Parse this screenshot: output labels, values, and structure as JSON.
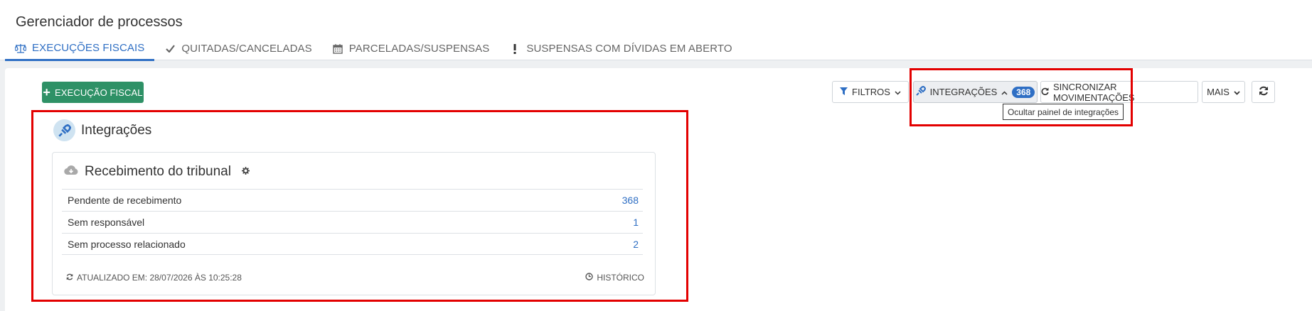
{
  "header": {
    "title": "Gerenciador de processos",
    "tabs": [
      {
        "label": "EXECUÇÕES FISCAIS",
        "icon": "scale-icon",
        "active": true
      },
      {
        "label": "QUITADAS/CANCELADAS",
        "icon": "check-icon",
        "active": false
      },
      {
        "label": "PARCELADAS/SUSPENSAS",
        "icon": "calendar-icon",
        "active": false
      },
      {
        "label": "SUSPENSAS COM DÍVIDAS EM ABERTO",
        "icon": "exclamation-icon",
        "active": false
      }
    ]
  },
  "actions": {
    "new_label": "EXECUÇÃO FISCAL",
    "filters_label": "FILTROS",
    "integrations_label": "INTEGRAÇÕES",
    "integrations_count": "368",
    "sync_label": "SINCRONIZAR MOVIMENTAÇÕES",
    "more_label": "MAIS",
    "tooltip": "Ocultar painel de integrações"
  },
  "panel": {
    "title": "Integrações",
    "card": {
      "title": "Recebimento do tribunal",
      "rows": [
        {
          "label": "Pendente de recebimento",
          "value": "368"
        },
        {
          "label": "Sem responsável",
          "value": "1"
        },
        {
          "label": "Sem processo relacionado",
          "value": "2"
        }
      ],
      "updated": "ATUALIZADO EM: 28/07/2026 ÀS 10:25:28",
      "history": "HISTÓRICO"
    }
  },
  "colors": {
    "accent": "#2f6fc4",
    "success": "#2e9166",
    "highlight": "#e30000"
  }
}
